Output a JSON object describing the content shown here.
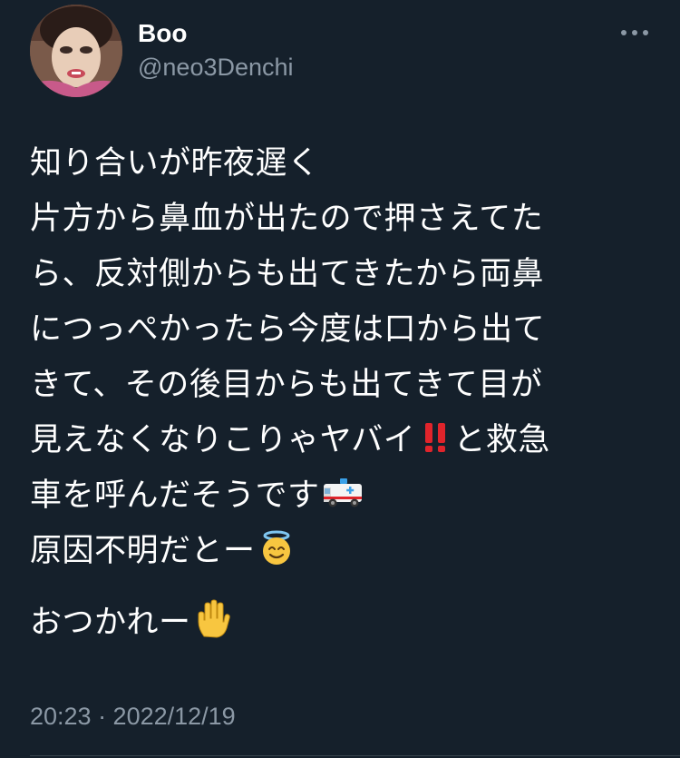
{
  "author": {
    "display_name": "Boo",
    "handle": "@neo3Denchi"
  },
  "more_icon": "more-horizontal-icon",
  "tweet": {
    "lines": [
      "知り合いが昨夜遅く",
      "片方から鼻血が出たので押さえてた",
      "ら、反対側からも出てきたから両鼻",
      "につっぺかったら今度は口から出て",
      "きて、その後目からも出てきて目が",
      "見えなくなりこりゃヤバイ",
      "と救急",
      "車を呼んだそうです",
      "原因不明だとー",
      "おつかれー"
    ],
    "emojis": {
      "exclamation": "double-exclamation-icon",
      "ambulance": "ambulance-icon",
      "halo": "smiling-halo-face-icon",
      "hand": "raised-hand-icon"
    }
  },
  "timestamp": "20:23 · 2022/12/19",
  "colors": {
    "background": "#15202b",
    "text": "#ffffff",
    "secondary": "#8b98a5",
    "divider": "#38444d",
    "exclamation": "#e0242b"
  }
}
